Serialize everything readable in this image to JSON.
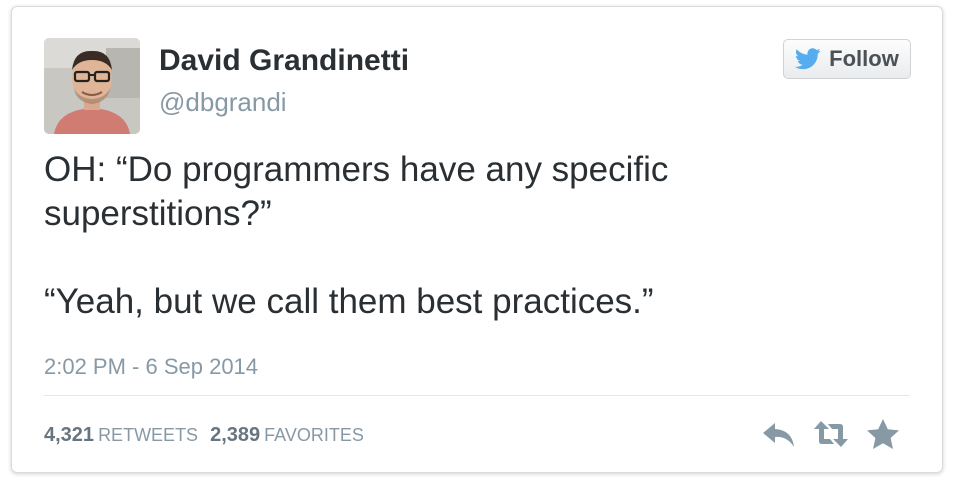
{
  "user": {
    "display_name": "David Grandinetti",
    "screen_name": "@dbgrandi",
    "avatar_icon": "profile-photo"
  },
  "follow_button": {
    "label": "Follow",
    "icon": "twitter-bird-icon"
  },
  "tweet": {
    "lines": [
      "OH: “Do programmers have any specific",
      "superstitions?”",
      "“Yeah, but we call them best practices.”"
    ],
    "timestamp": "2:02 PM - 6 Sep 2014"
  },
  "stats": {
    "retweets_count": "4,321",
    "retweets_label": "RETWEETS",
    "favorites_count": "2,389",
    "favorites_label": "FAVORITES"
  },
  "actions": [
    "reply-icon",
    "retweet-icon",
    "favorite-icon"
  ],
  "colors": {
    "text": "#292f33",
    "muted": "#8899a6",
    "twitter_blue": "#55acee",
    "icon_gray": "#8899a6"
  }
}
